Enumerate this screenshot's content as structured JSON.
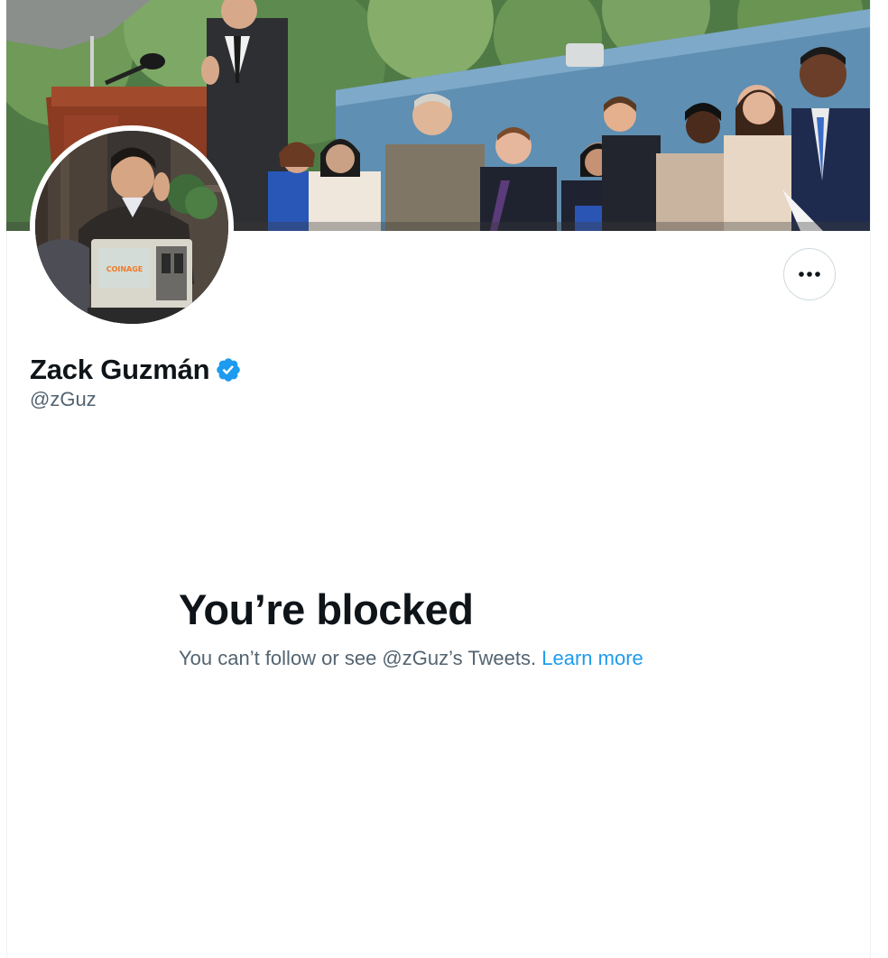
{
  "profile": {
    "display_name": "Zack Guzmán",
    "handle": "@zGuz",
    "verified": true
  },
  "avatar_screen_text": "COINAGE",
  "icons": {
    "verified": "verified-badge-icon",
    "more": "more-horizontal-icon"
  },
  "blocked": {
    "title": "You’re blocked",
    "message": "You can’t follow or see @zGuz’s Tweets.",
    "learn_more": "Learn more"
  },
  "colors": {
    "accent": "#1d9bf0",
    "text_primary": "#0f1419",
    "text_secondary": "#536471",
    "border": "#cfd9de"
  }
}
